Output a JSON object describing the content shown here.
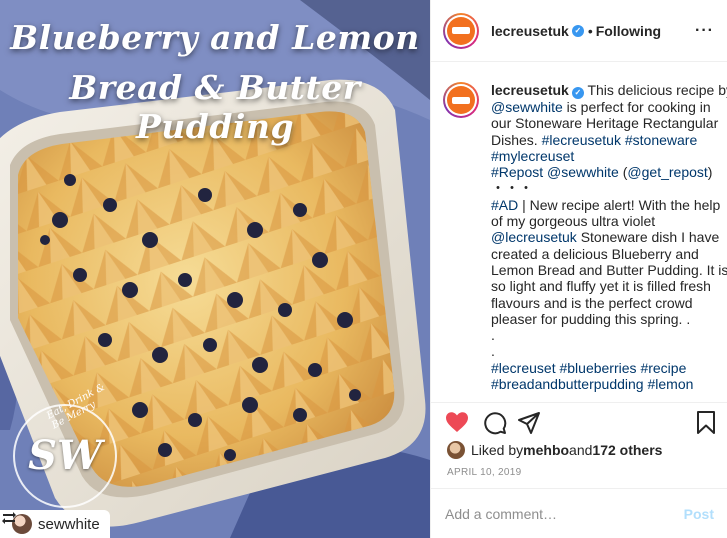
{
  "photo": {
    "title_line1": "Blueberry and Lemon",
    "title_line2": "Bread & Butter Pudding",
    "watermark_mono": "SW",
    "watermark_ring": "Eat, Drink & Be Merry",
    "repost_icon": "repost-icon",
    "repost_user": "sewwhite"
  },
  "header": {
    "username": "lecreusetuk",
    "verified_icon": "verified-badge-icon",
    "separator": "•",
    "follow_label": "Following",
    "more_icon": "more-options-icon"
  },
  "caption": {
    "username": "lecreusetuk",
    "lines": [
      [
        {
          "t": "lecreusetuk",
          "k": "user"
        },
        {
          "t": " This delicious recipe by",
          "k": "text"
        }
      ],
      [
        {
          "t": "@sewwhite",
          "k": "link"
        },
        {
          "t": " is perfect for cooking in",
          "k": "text"
        }
      ],
      [
        {
          "t": "our Stoneware Heritage Rectangular",
          "k": "text"
        }
      ],
      [
        {
          "t": "Dishes. ",
          "k": "text"
        },
        {
          "t": "#lecreusetuk",
          "k": "link"
        },
        {
          "t": " ",
          "k": "text"
        },
        {
          "t": "#stoneware",
          "k": "link"
        }
      ],
      [
        {
          "t": "#mylecreuset",
          "k": "link"
        }
      ],
      [
        {
          "t": "#Repost",
          "k": "link"
        },
        {
          "t": " ",
          "k": "text"
        },
        {
          "t": "@sewwhite",
          "k": "link"
        },
        {
          "t": " (",
          "k": "text"
        },
        {
          "t": "@get_repost",
          "k": "link"
        },
        {
          "t": ")",
          "k": "text"
        }
      ],
      [
        {
          "t": "・・・",
          "k": "text"
        }
      ],
      [
        {
          "t": "#AD",
          "k": "link"
        },
        {
          "t": " | New recipe alert! With the help",
          "k": "text"
        }
      ],
      [
        {
          "t": "of my gorgeous ultra violet",
          "k": "text"
        }
      ],
      [
        {
          "t": "@lecreusetuk",
          "k": "link"
        },
        {
          "t": " Stoneware dish I have",
          "k": "text"
        }
      ],
      [
        {
          "t": "created a delicious Blueberry and",
          "k": "text"
        }
      ],
      [
        {
          "t": "Lemon Bread and Butter Pudding. It is",
          "k": "text"
        }
      ],
      [
        {
          "t": "so light and fluffy yet it is filled fresh",
          "k": "text"
        }
      ],
      [
        {
          "t": "flavours and is the perfect crowd",
          "k": "text"
        }
      ],
      [
        {
          "t": "pleaser for pudding this spring. .",
          "k": "text"
        }
      ],
      [
        {
          "t": ".",
          "k": "text"
        }
      ],
      [
        {
          "t": ".",
          "k": "text"
        }
      ],
      [
        {
          "t": "#lecreuset",
          "k": "link"
        },
        {
          "t": " ",
          "k": "text"
        },
        {
          "t": "#blueberries",
          "k": "link"
        },
        {
          "t": " ",
          "k": "text"
        },
        {
          "t": "#recipe",
          "k": "link"
        }
      ],
      [
        {
          "t": "#breadandbutterpudding",
          "k": "link"
        },
        {
          "t": " ",
          "k": "text"
        },
        {
          "t": "#lemon",
          "k": "link"
        }
      ]
    ]
  },
  "actions": {
    "like_icon": "heart-filled-icon",
    "comment_icon": "comment-icon",
    "share_icon": "share-icon",
    "save_icon": "bookmark-icon",
    "like_color": "#ed4956"
  },
  "likes": {
    "prefix": "Liked by ",
    "user": "mehbo",
    "middle": " and ",
    "count": "172 others"
  },
  "date": "APRIL 10, 2019",
  "comment": {
    "placeholder": "Add a comment…",
    "post_label": "Post"
  },
  "colors": {
    "link": "#00376b",
    "brand_orange": "#f2701f",
    "post_disabled": "#b2dffc",
    "verified_blue": "#3897f0"
  }
}
